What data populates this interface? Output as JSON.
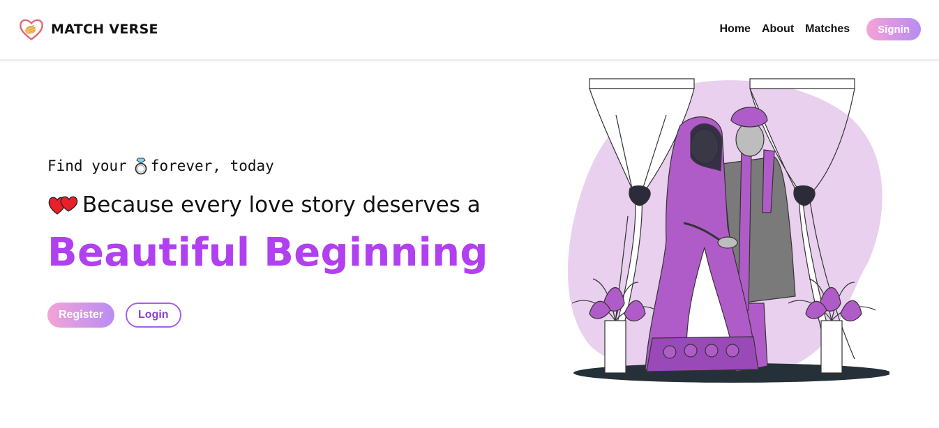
{
  "nav": {
    "brand": "MATCH VERSE",
    "links": [
      "Home",
      "About",
      "Matches"
    ],
    "signin_label": "Signin"
  },
  "hero": {
    "tagline_before": "Find your",
    "tagline_after": "forever, today",
    "subheading": "Because every love story deserves a",
    "headline": "Beautiful Beginning",
    "register_label": "Register",
    "login_label": "Login"
  },
  "icons": {
    "logo": "heart-hands-logo-icon",
    "tagline": "ring-icon",
    "subheading": "two-hearts-icon",
    "illustration": "wedding-couple-illustration"
  },
  "colors": {
    "accent": "#b040f0",
    "gradient_start": "#f3a4d7",
    "gradient_end": "#b98cf2",
    "illustration_purple": "#b05cc8",
    "illustration_bg": "#e8d0ee"
  }
}
